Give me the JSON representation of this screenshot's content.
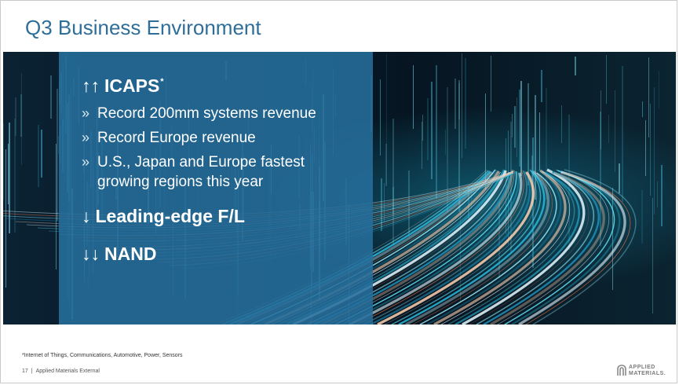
{
  "slide": {
    "title": "Q3 Business Environment",
    "headings": {
      "icaps": {
        "arrows": "↑↑",
        "label": "ICAPS",
        "sup": "*"
      },
      "leading_edge": {
        "arrows": "↓",
        "label": "Leading-edge F/L"
      },
      "nand": {
        "arrows": "↓↓",
        "label": "NAND"
      }
    },
    "bullet_marker": "»",
    "bullets": [
      "Record 200mm systems revenue",
      "Record Europe revenue",
      "U.S., Japan and Europe fastest growing regions this year"
    ],
    "footnote": "*Internet of Things, Communications, Automotive, Power, Sensors",
    "footer": {
      "page_number": "17",
      "separator": "|",
      "label": "Applied Materials External"
    },
    "logo": {
      "line1": "APPLIED",
      "line2": "MATERIALS."
    }
  },
  "colors": {
    "title": "#2f6e99",
    "panel": "#266e9c",
    "hero_background": "#06131d",
    "light_streak": "#4fd6f0"
  },
  "icons": {
    "logo": "applied-materials-logo-icon"
  }
}
